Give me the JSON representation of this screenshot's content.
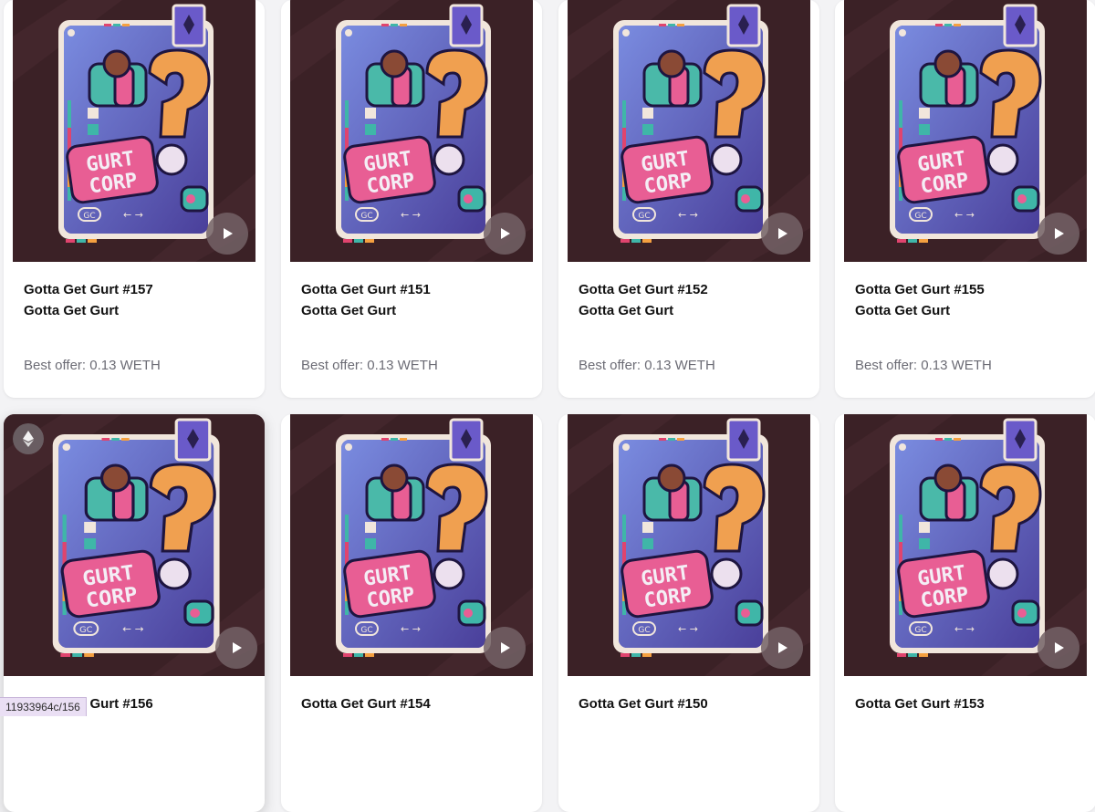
{
  "cards": [
    {
      "title": "Gotta Get Gurt #157",
      "collection": "Gotta Get Gurt",
      "offer": "Best offer: 0.13 WETH"
    },
    {
      "title": "Gotta Get Gurt #151",
      "collection": "Gotta Get Gurt",
      "offer": "Best offer: 0.13 WETH"
    },
    {
      "title": "Gotta Get Gurt #152",
      "collection": "Gotta Get Gurt",
      "offer": "Best offer: 0.13 WETH"
    },
    {
      "title": "Gotta Get Gurt #155",
      "collection": "Gotta Get Gurt",
      "offer": "Best offer: 0.13 WETH"
    },
    {
      "title": "Gotta Get Gurt #156",
      "collection": "",
      "offer": ""
    },
    {
      "title": "Gotta Get Gurt #154",
      "collection": "",
      "offer": ""
    },
    {
      "title": "Gotta Get Gurt #150",
      "collection": "",
      "offer": ""
    },
    {
      "title": "Gotta Get Gurt #153",
      "collection": "",
      "offer": ""
    }
  ],
  "artwork": {
    "logo_line1": "GURT",
    "logo_line2": "CORP",
    "badge": "GC",
    "arrows": "← →",
    "question_mark": "?"
  },
  "icons": {
    "play": "play-icon",
    "chain": "ethereum-icon"
  },
  "colors": {
    "card_bg": "#ffffff",
    "media_bg": "#3b2126",
    "offer_text": "#6c6c75",
    "title_text": "#111111"
  },
  "status_bar": {
    "url": "11933964c/156"
  }
}
